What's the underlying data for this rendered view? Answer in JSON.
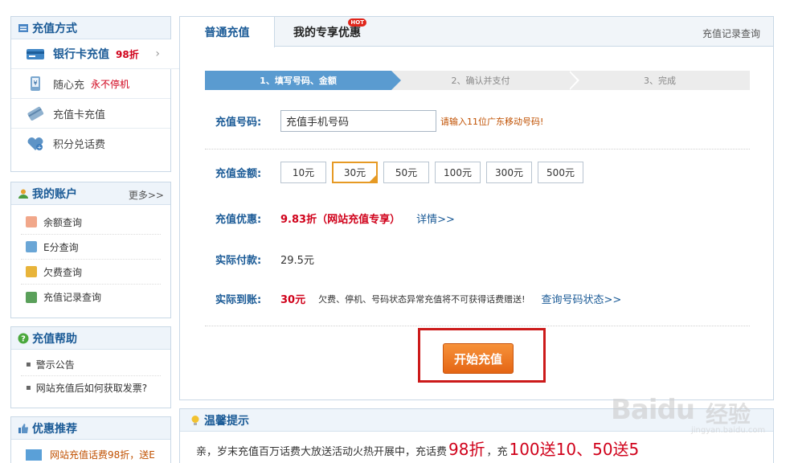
{
  "sidebar": {
    "pay_methods": {
      "title": "充值方式",
      "items": [
        {
          "label": "银行卡充值",
          "tag": "98折",
          "icon": "bank-card-icon"
        },
        {
          "label": "随心充",
          "tag": "永不停机",
          "icon": "phone-bill-icon"
        },
        {
          "label": "充值卡充值",
          "icon": "recharge-card-icon"
        },
        {
          "label": "积分兑话费",
          "icon": "heart-points-icon"
        }
      ]
    },
    "account": {
      "title": "我的账户",
      "more": "更多>>",
      "items": [
        {
          "label": "余额查询"
        },
        {
          "label": "E分查询"
        },
        {
          "label": "欠费查询"
        },
        {
          "label": "充值记录查询"
        }
      ]
    },
    "help": {
      "title": "充值帮助",
      "items": [
        {
          "label": "警示公告"
        },
        {
          "label": "网站充值后如何获取发票?"
        }
      ]
    },
    "promo": {
      "title": "优惠推荐",
      "first_item": "网站充值话费98折，送E"
    }
  },
  "main": {
    "tabs": [
      {
        "label": "普通充值"
      },
      {
        "label": "我的专享优惠"
      }
    ],
    "hot_badge": "HOT",
    "record_link": "充值记录查询",
    "steps": [
      "1、填写号码、金额",
      "2、确认并支付",
      "3、完成"
    ],
    "phone": {
      "label": "充值号码:",
      "value": "充值手机号码",
      "hint": "请输入11位广东移动号码!"
    },
    "amount": {
      "label": "充值金额:",
      "options": [
        "10元",
        "30元",
        "50元",
        "100元",
        "300元",
        "500元"
      ],
      "selected": "30元"
    },
    "discount": {
      "label": "充值优惠:",
      "value": "9.83折（网站充值专享）",
      "link": "详情>>"
    },
    "actual_pay": {
      "label": "实际付款:",
      "value": "29.5元"
    },
    "actual_credit": {
      "label": "实际到账:",
      "value": "30元",
      "note": "欠费、停机、号码状态异常充值将不可获得话费赠送!",
      "link": "查询号码状态>>"
    },
    "start_button": "开始充值"
  },
  "tips": {
    "title": "温馨提示",
    "text_1": "亲，岁末充值百万话费大放送活动火热开展中，充话费",
    "big_1": "98折",
    "text_2": "，充",
    "big_2": "100送10、50送5"
  },
  "watermark": {
    "brand": "Baidu",
    "brand_cn": "经验",
    "url": "jingyan.baidu.com"
  },
  "colors": {
    "accent_blue": "#1a5a96",
    "step_active": "#5a9bd0",
    "price_red": "#d0021b",
    "button_orange": "#e46514",
    "highlight_frame": "#cc1a1a"
  }
}
